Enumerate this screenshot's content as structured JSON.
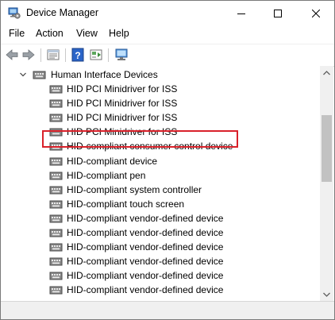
{
  "window": {
    "title": "Device Manager",
    "title_icon": "device-manager-icon"
  },
  "menu": {
    "file": "File",
    "action": "Action",
    "view": "View",
    "help": "Help"
  },
  "toolbar": {
    "buttons": [
      "back-arrow-icon",
      "forward-arrow-icon",
      "properties-icon",
      "help-icon",
      "show-hidden-icon",
      "scan-hardware-icon"
    ]
  },
  "tree": {
    "category": {
      "label": "Human Interface Devices",
      "expanded": true
    },
    "items": [
      {
        "label": "HID PCI Minidriver for ISS"
      },
      {
        "label": "HID PCI Minidriver for ISS"
      },
      {
        "label": "HID PCI Minidriver for ISS"
      },
      {
        "label": "HID PCI Minidriver for ISS"
      },
      {
        "label": "HID-compliant consumer control device"
      },
      {
        "label": "HID-compliant device"
      },
      {
        "label": "HID-compliant pen"
      },
      {
        "label": "HID-compliant system controller"
      },
      {
        "label": "HID-compliant touch screen"
      },
      {
        "label": "HID-compliant vendor-defined device"
      },
      {
        "label": "HID-compliant vendor-defined device"
      },
      {
        "label": "HID-compliant vendor-defined device"
      },
      {
        "label": "HID-compliant vendor-defined device"
      },
      {
        "label": "HID-compliant vendor-defined device"
      },
      {
        "label": "HID-compliant vendor-defined device"
      }
    ],
    "highlighted_index": 8
  },
  "colors": {
    "highlight_border": "#d9212a",
    "scroll_thumb": "#c2c2c2"
  }
}
